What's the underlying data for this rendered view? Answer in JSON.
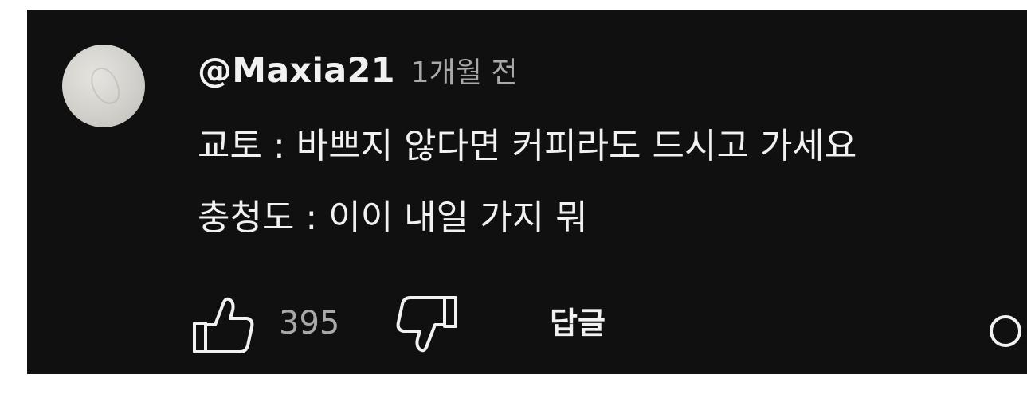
{
  "comment": {
    "author": "@Maxia21",
    "timestamp": "1개월 전",
    "body_lines": [
      "교토 : 바쁘지 않다면 커피라도 드시고 가세요",
      "충청도 : 이이 내일 가지 뭐"
    ]
  },
  "actions": {
    "like_icon": "thumbs-up-icon",
    "like_count": "395",
    "dislike_icon": "thumbs-down-icon",
    "reply_label": "답글"
  },
  "colors": {
    "background": "#101010",
    "primary_text": "#f1f1f1",
    "secondary_text": "#a9a9a9"
  }
}
